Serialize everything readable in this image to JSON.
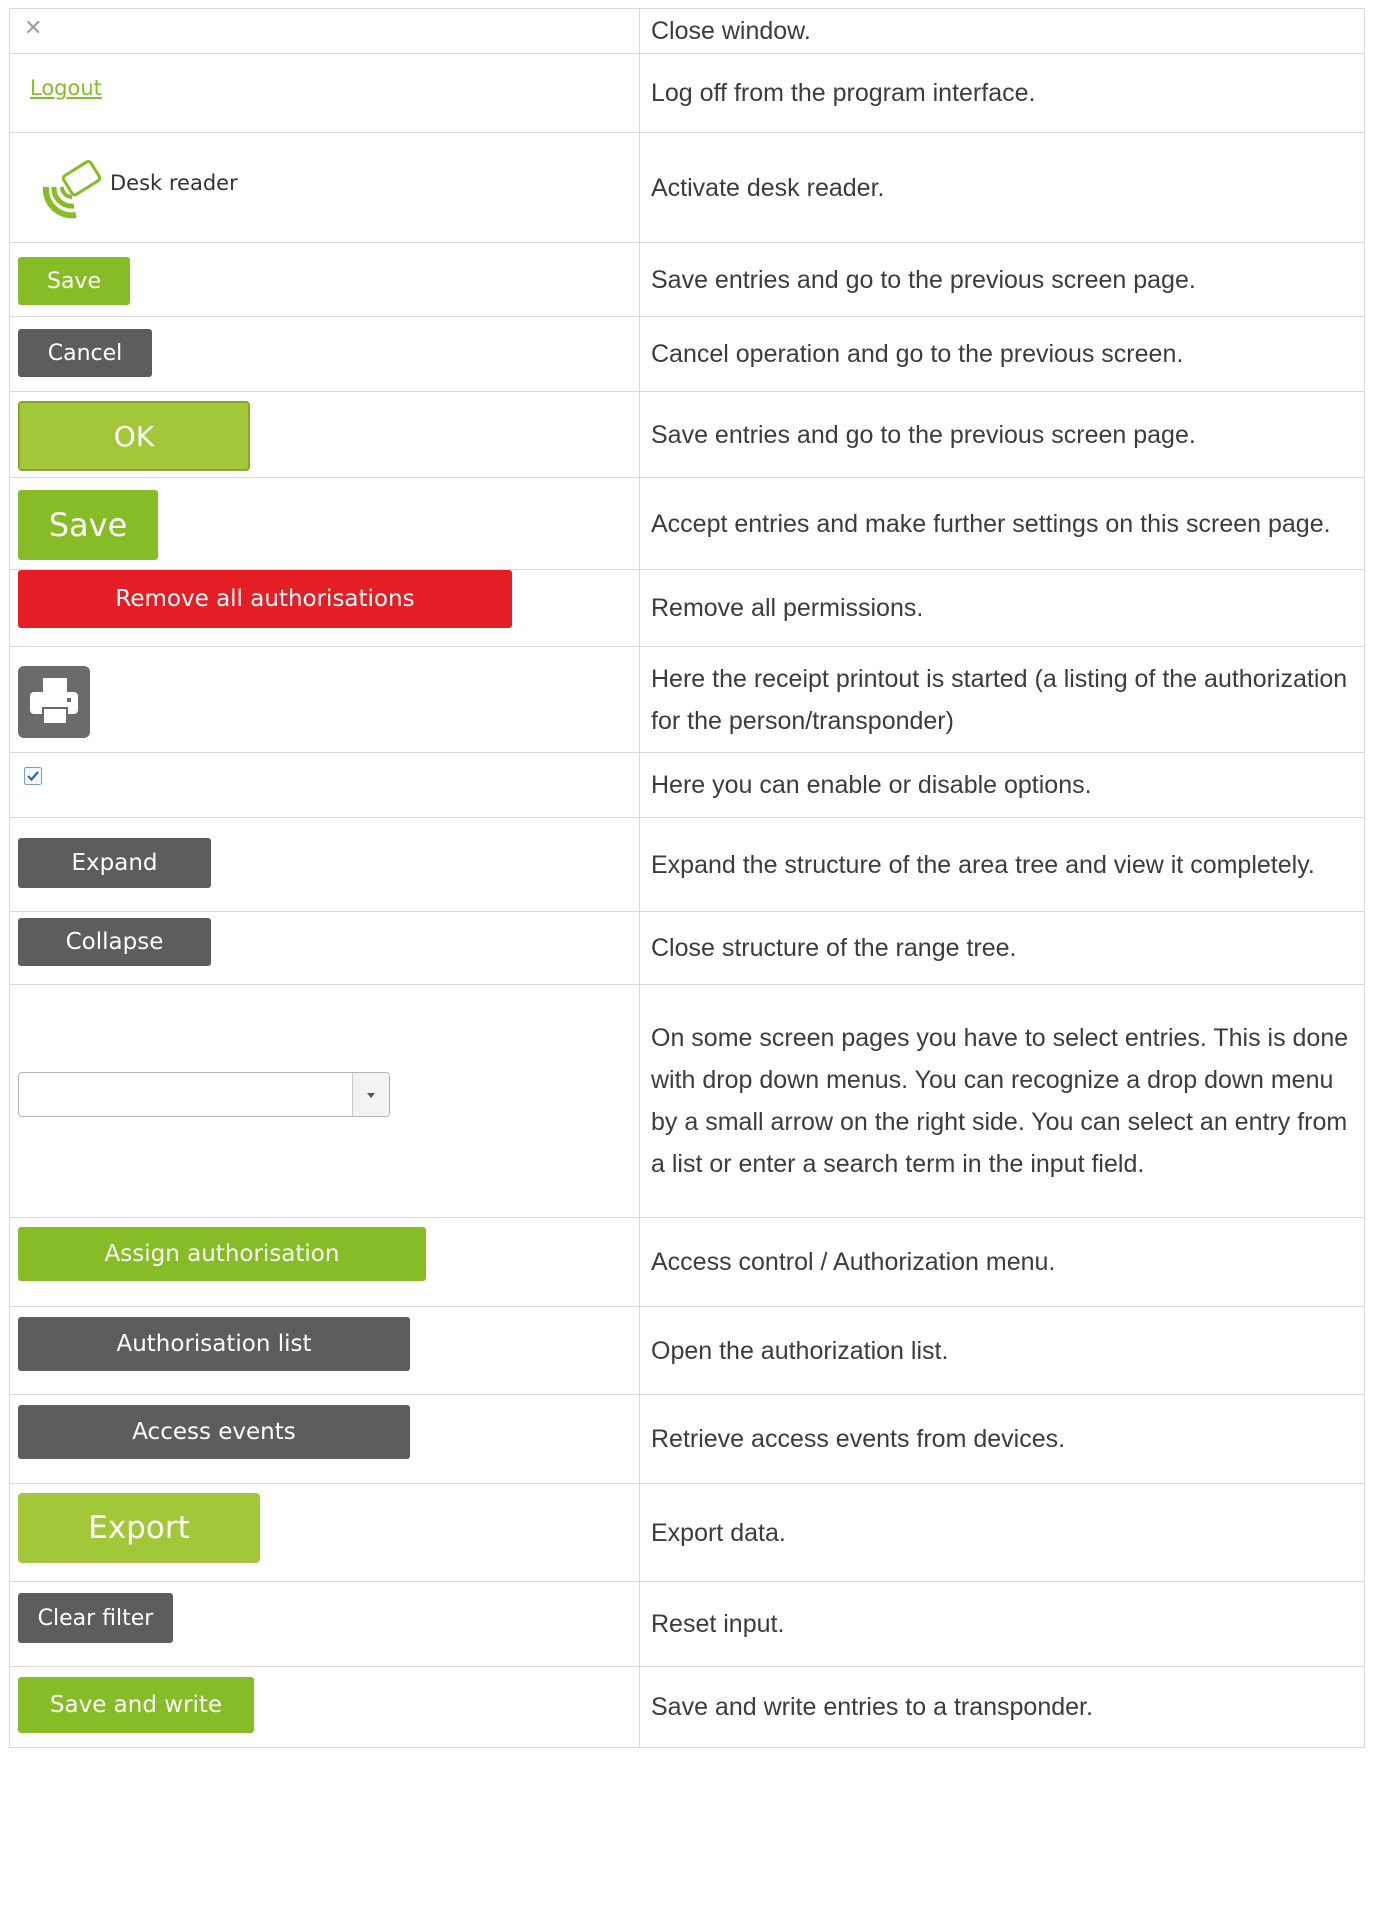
{
  "rows": [
    {
      "control": {
        "type": "icon",
        "icon": "close-icon",
        "glyph": "✕"
      },
      "description": "Close window."
    },
    {
      "control": {
        "type": "link",
        "label": "Logout"
      },
      "description": "Log off from the program interface."
    },
    {
      "control": {
        "type": "icon-label",
        "icon": "desk-reader-icon",
        "label": "Desk reader"
      },
      "description": "Activate desk reader."
    },
    {
      "control": {
        "type": "button",
        "label": "Save",
        "color": "#86bc25"
      },
      "description": "Save entries and go to the previous screen page."
    },
    {
      "control": {
        "type": "button",
        "label": "Cancel",
        "color": "#5d5d5d"
      },
      "description": "Cancel operation and go to the previous screen."
    },
    {
      "control": {
        "type": "button",
        "label": "OK",
        "color": "#a2c83a"
      },
      "description": "Save entries and go to the previous screen page."
    },
    {
      "control": {
        "type": "button",
        "label": "Save",
        "color": "#86bc25"
      },
      "description": "Accept entries and make further settings on this screen page."
    },
    {
      "control": {
        "type": "button",
        "label": "Remove all authorisations",
        "color": "#e51e26"
      },
      "description": "Remove all permissions."
    },
    {
      "control": {
        "type": "icon",
        "icon": "printer-icon"
      },
      "description": "Here the receipt printout is started (a listing of the authorization for the person/transponder)"
    },
    {
      "control": {
        "type": "checkbox",
        "checked": true,
        "icon": "checkbox-checked-icon"
      },
      "description": "Here you can enable or disable options."
    },
    {
      "control": {
        "type": "button",
        "label": "Expand",
        "color": "#5d5d5d"
      },
      "description": "Expand the structure of the area tree and view it completely."
    },
    {
      "control": {
        "type": "button",
        "label": "Collapse",
        "color": "#5d5d5d"
      },
      "description": "Close structure of the range tree."
    },
    {
      "control": {
        "type": "dropdown",
        "value": "",
        "icon": "caret-down-icon"
      },
      "description": "On some screen pages you have to select entries. This is done with drop down menus. You can recognize a drop down menu by a small arrow on the right side. You can select an entry from a list or enter a search term in the input field."
    },
    {
      "control": {
        "type": "button",
        "label": "Assign authorisation",
        "color": "#86bc25"
      },
      "description": "Access control / Authorization menu."
    },
    {
      "control": {
        "type": "button",
        "label": "Authorisation list",
        "color": "#5d5d5d"
      },
      "description": "Open the authorization list."
    },
    {
      "control": {
        "type": "button",
        "label": "Access events",
        "color": "#5d5d5d"
      },
      "description": "Retrieve access events from devices."
    },
    {
      "control": {
        "type": "button",
        "label": "Export",
        "color": "#a2c83a"
      },
      "description": "Export data."
    },
    {
      "control": {
        "type": "button",
        "label": "Clear filter",
        "color": "#5d5d5d"
      },
      "description": "Reset input."
    },
    {
      "control": {
        "type": "button",
        "label": "Save and write",
        "color": "#86bc25"
      },
      "description": "Save and write entries to a transponder."
    }
  ]
}
